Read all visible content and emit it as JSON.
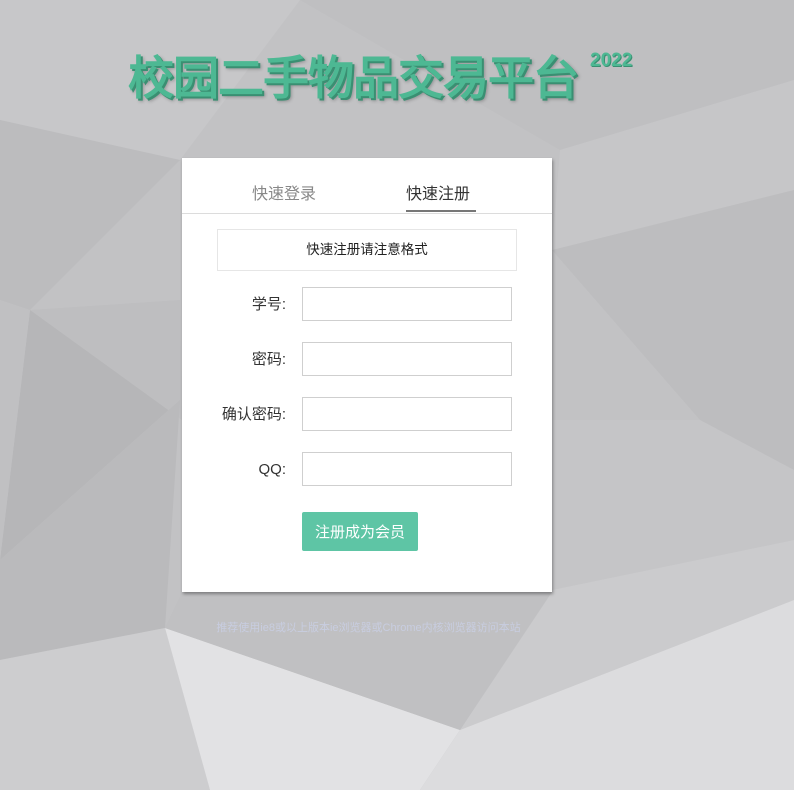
{
  "page": {
    "title": "校园二手物品交易平台",
    "year": "2022"
  },
  "tabs": [
    {
      "label": "快速登录",
      "active": false
    },
    {
      "label": "快速注册",
      "active": true
    }
  ],
  "form": {
    "notice": "快速注册请注意格式",
    "fields": [
      {
        "label": "学号:",
        "value": "",
        "placeholder": ""
      },
      {
        "label": "密码:",
        "value": "",
        "placeholder": ""
      },
      {
        "label": "确认密码:",
        "value": "",
        "placeholder": ""
      },
      {
        "label": "QQ:",
        "value": "",
        "placeholder": ""
      }
    ],
    "submit_label": "注册成为会员"
  },
  "footer": {
    "note": "推荐使用ie8或以上版本ie浏览器或Chrome内核浏览器访问本站"
  },
  "colors": {
    "accent": "#4db893",
    "button": "#5ec5a5",
    "background": "#c3c3c5"
  }
}
